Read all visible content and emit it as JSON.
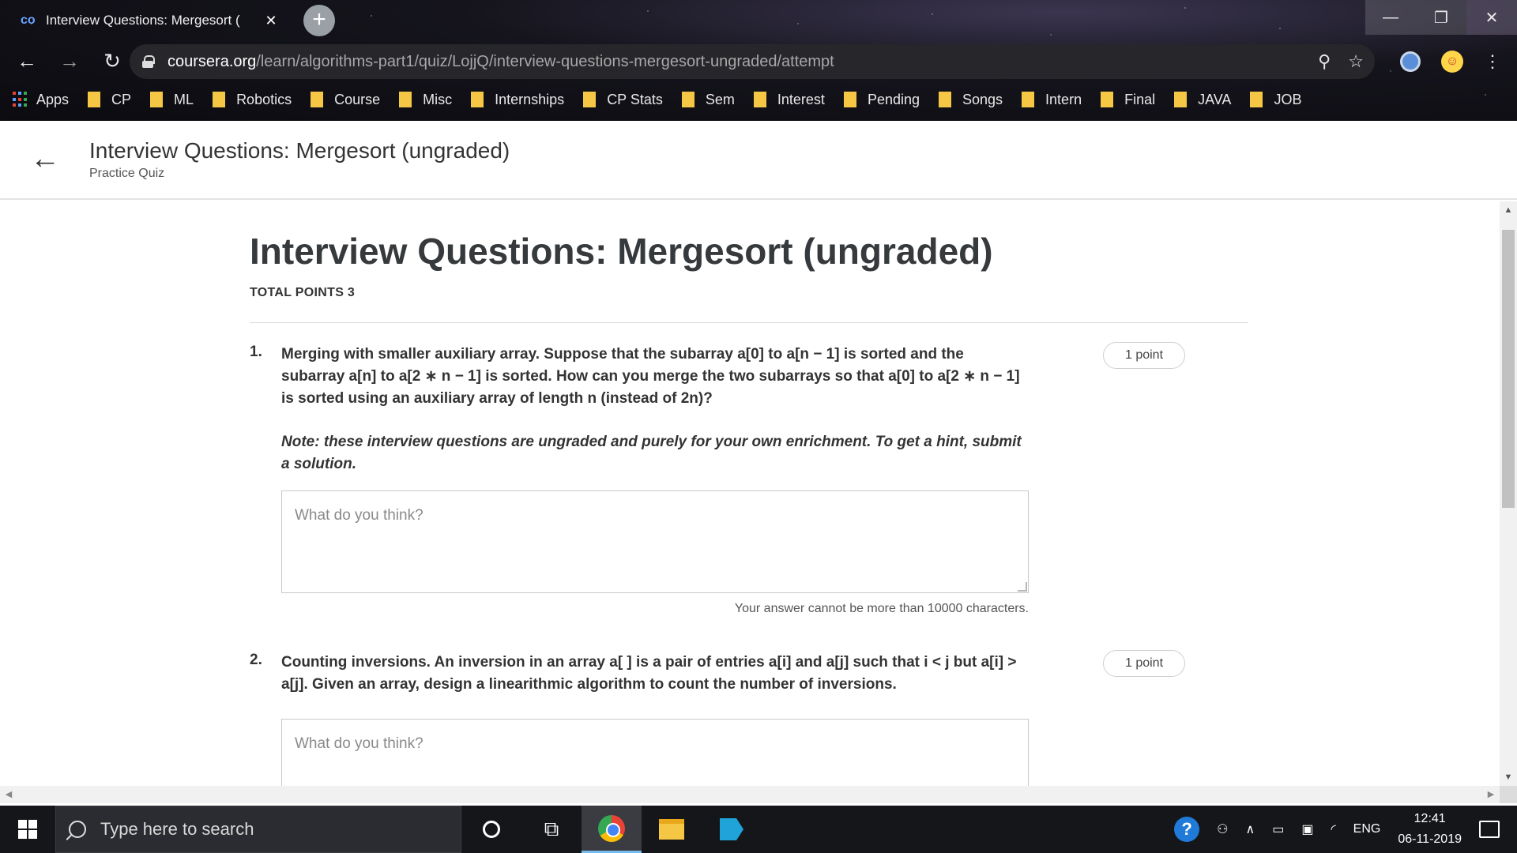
{
  "browser": {
    "tab_title": "Interview Questions: Mergesort (",
    "url_host": "coursera.org",
    "url_path": "/learn/algorithms-part1/quiz/LojjQ/interview-questions-mergesort-ungraded/attempt",
    "bookmarks": [
      "Apps",
      "CP",
      "ML",
      "Robotics",
      "Course",
      "Misc",
      "Internships",
      "CP Stats",
      "Sem",
      "Interest",
      "Pending",
      "Songs",
      "Intern",
      "Final",
      "JAVA",
      "JOB"
    ]
  },
  "header": {
    "title": "Interview Questions: Mergesort (ungraded)",
    "subtitle": "Practice Quiz"
  },
  "quiz": {
    "title": "Interview Questions: Mergesort (ungraded)",
    "total_points": "TOTAL POINTS 3",
    "questions": [
      {
        "number": "1.",
        "text": "Merging with smaller auxiliary array. Suppose that the subarray a[0] to a[n − 1] is sorted and the subarray a[n] to a[2 ∗ n − 1] is sorted. How can you merge the two subarrays so that a[0] to a[2 ∗ n − 1] is sorted using an auxiliary array of length n (instead of 2n)?",
        "note": "Note: these interview questions are ungraded and purely for your own enrichment. To get a hint, submit a solution.",
        "points": "1 point",
        "placeholder": "What do you think?",
        "char_limit": "Your answer cannot be more than 10000 characters."
      },
      {
        "number": "2.",
        "text": "Counting inversions. An inversion in an array a[ ] is a pair of entries a[i] and a[j] such that i < j but a[i] > a[j]. Given an array, design a linearithmic algorithm to count the number of inversions.",
        "points": "1 point",
        "placeholder": "What do you think?"
      }
    ]
  },
  "taskbar": {
    "search_placeholder": "Type here to search",
    "language": "ENG",
    "time": "12:41",
    "date": "06-11-2019"
  }
}
